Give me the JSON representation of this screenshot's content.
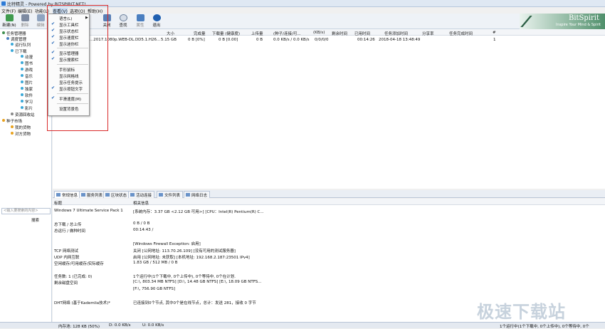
{
  "titlebar": {
    "title": "比特精灵 - Powered by BITSPIRIT.NET!"
  },
  "menubar": {
    "items": [
      "文件(F)",
      "编辑(E)",
      "功能(L)",
      "查看(V)",
      "选项(O)",
      "帮助(H)"
    ]
  },
  "toolbar": {
    "buttons": [
      "新建(N)",
      "删除",
      "编辑",
      "",
      "",
      "关闭",
      "查找",
      "属性",
      "退出"
    ]
  },
  "logo": {
    "text": "BitSpirit",
    "slogan": "Inspire Your Mind & Spirit"
  },
  "sidebar": {
    "tree": [
      "任务管理器",
      "调度管理",
      "运行队列",
      "已下载",
      "动漫",
      "图书",
      "游戏",
      "音乐",
      "图片",
      "独家",
      "软件",
      "学习",
      "影片",
      "资源回收站",
      "种子市场",
      "我的货物",
      "对方货物"
    ],
    "search_placeholder": "<输入要搜索的内容>",
    "search_button": "搜索"
  },
  "table": {
    "columns": [
      "大小",
      "完成量",
      "下载量 (健康度)",
      "上传量",
      "(种子/连接/可...",
      "(KB/s)",
      "剩余时间",
      "已用时间",
      "任务添加时间",
      "分享率",
      "任务完成时间",
      "#"
    ],
    "row": {
      "name": "...2017.1080p.WEB-DL.DD5.1.H26...",
      "size": "5.15 GB",
      "done": "0 B [0%]",
      "downloaded": "0 B [0.00]",
      "uploaded": "0 B",
      "peers": "0/0/0/0",
      "speed": "0.0 KB/s / 0.0 KB/s",
      "elapsed": "00:14:26",
      "added": "2018-04-18 13:48:49",
      "index": "1"
    }
  },
  "view_menu": {
    "items": [
      {
        "label": "语言(L)",
        "checked": false,
        "arrow": true
      },
      {
        "label": "显示工具栏",
        "checked": true
      },
      {
        "label": "显示状态栏",
        "checked": true
      },
      {
        "label": "显示速度栏",
        "checked": true
      },
      {
        "label": "显示迷你栏",
        "checked": true
      },
      {
        "label": "显示管理器",
        "checked": true
      },
      {
        "label": "显示搜索栏",
        "checked": true
      },
      {
        "label": "手形鼠标",
        "checked": false
      },
      {
        "label": "显示网格线",
        "checked": false
      },
      {
        "label": "显示任务提示",
        "checked": false
      },
      {
        "label": "显示按钮文字",
        "checked": true
      },
      {
        "label": "平滑速度(M)",
        "checked": true
      },
      {
        "label": "设置背景色",
        "checked": false
      }
    ]
  },
  "tabs": [
    "常规信息",
    "服务列表",
    "区块状态",
    "活动连接",
    "文件列表",
    "网络日志"
  ],
  "info": {
    "header_label": "标题",
    "header_value": "相关信息",
    "rows": [
      {
        "label": "Windows 7 Ultimate Service Pack 1",
        "value": "[系统内存：3.37 GB <2.12 GB 可用>] [CPU：Intel(R) Pentium(R) C..."
      },
      {
        "label": "总下载 / 总上传",
        "value": "0 B / 0 B"
      },
      {
        "label": "总运行 / 做种时间",
        "value": "00:14:43 /"
      },
      {
        "label": "",
        "value": "[Windows Firewall Exception: 启用]"
      },
      {
        "label": "TCP 网络测试",
        "value": "关闭 [公网地址: 113.70.26.109] [没有可用的测试服务器]"
      },
      {
        "label": "UDP 内网互联",
        "value": "启用 [公网地址: 未获取] [本机地址: 192.168.2.187:23501 IPv4]"
      },
      {
        "label": "空闲缓存/可用缓存/实际缓存",
        "value": "1.83 GB / 512 MB / 0 B"
      },
      {
        "label": "任务数: 1 (已完成: 0)",
        "value": "1个运行中(1个下载中, 0个上传中), 0个等待中, 0个在计划."
      },
      {
        "label": "剩余磁盘空间",
        "value": "[C:\\, 803.34 MB  NTFS]  [D:\\, 14.48 GB  NTFS]  [E:\\, 18.09 GB  NTFS..."
      },
      {
        "label": "",
        "value": "[F:\\, 756.90 GB  NTFS]"
      },
      {
        "label": "DHT网络 (基于Kademlia技术)*",
        "value": "已连接到0个节点, 其中0个是在线节点，总计：发送 281，接收 0 字节"
      }
    ]
  },
  "statusbar": {
    "mem": "内存池: 128 KB (50%)",
    "down": "D: 0.0 KB/s",
    "up": "U: 0.0 KB/s",
    "tasks": "1个运行中(1个下载中, 0个上传中), 0个等待中, 0个"
  },
  "watermark": "极速下载站",
  "colors": {
    "highlight": "#d92b2b",
    "accent": "#1a5fb4",
    "logo": "#4f8f6b"
  }
}
